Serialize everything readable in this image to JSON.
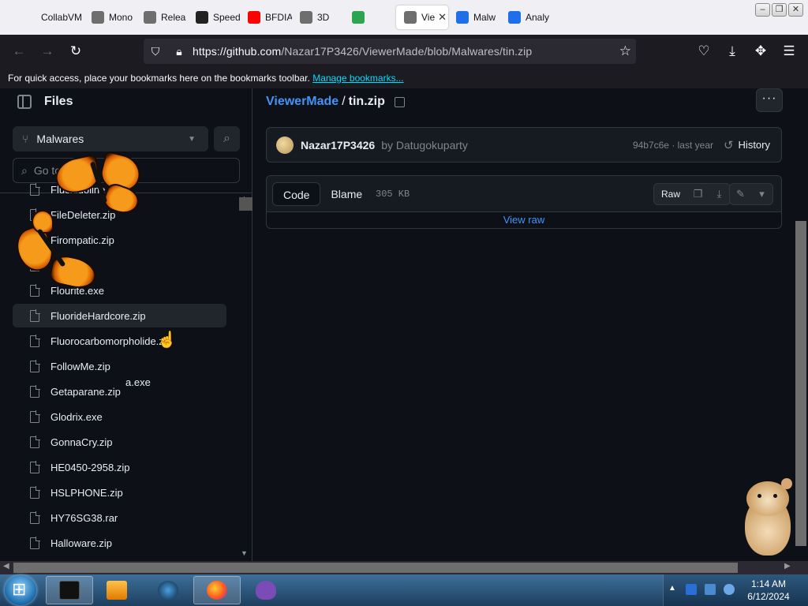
{
  "browser": {
    "tabs": [
      {
        "label": "CollabVM",
        "color": "#f0f0f4",
        "active": false
      },
      {
        "label": "Mono",
        "color": "#6e6e6e",
        "active": false
      },
      {
        "label": "Relea",
        "color": "#6e6e6e",
        "active": false
      },
      {
        "label": "Speed",
        "color": "#222222",
        "active": false
      },
      {
        "label": "BFDIA",
        "color": "#ff0000",
        "active": false
      },
      {
        "label": "3D",
        "color": "#6e6e6e",
        "active": false
      },
      {
        "label": "",
        "color": "#2da44e",
        "active": false
      },
      {
        "label": "Vie",
        "color": "#6e6e6e",
        "active": true
      },
      {
        "label": "Malw",
        "color": "#1f6feb",
        "active": false
      },
      {
        "label": "Analy",
        "color": "#1f6feb",
        "active": false
      }
    ],
    "url_host": "https://github.com",
    "url_path": "/Nazar17P3426/ViewerMade/blob/Malwares/tin.zip",
    "bookmarks_text": "For quick access, place your bookmarks here on the bookmarks toolbar.",
    "bookmarks_link": "Manage bookmarks..."
  },
  "sidebar": {
    "title": "Files",
    "branch": "Malwares",
    "goto_placeholder": "Go to",
    "items": [
      "Fluoxidoline...",
      "FileDeleter.zip",
      "Firompatic.zip",
      "",
      "Flourite.exe",
      "FluorideHardcore.zip",
      "Fluorocarbomorpholide.zip",
      "FollowMe.zip",
      "Getaparane.zip",
      "Glodrix.exe",
      "GonnaCry.zip",
      "HE0450-2958.zip",
      "HSLPHONE.zip",
      "HY76SG38.rar",
      "Halloware.zip"
    ],
    "ghost_text": "a.exe"
  },
  "main": {
    "repo": "ViewerMade",
    "separator": "/",
    "file": "tin.zip",
    "author": "Nazar17P3426",
    "by": "by Datugokuparty",
    "commit_meta": "94b7c6e · last year",
    "history": "History",
    "code_tab": "Code",
    "blame_tab": "Blame",
    "size": "305 KB",
    "raw": "Raw",
    "view_raw": "View raw",
    "kebab": "···"
  },
  "taskbar": {
    "time": "1:14 AM",
    "date": "6/12/2024"
  },
  "colors": {
    "link": "#4493f8",
    "bg": "#0d1117",
    "border": "#30363d"
  }
}
